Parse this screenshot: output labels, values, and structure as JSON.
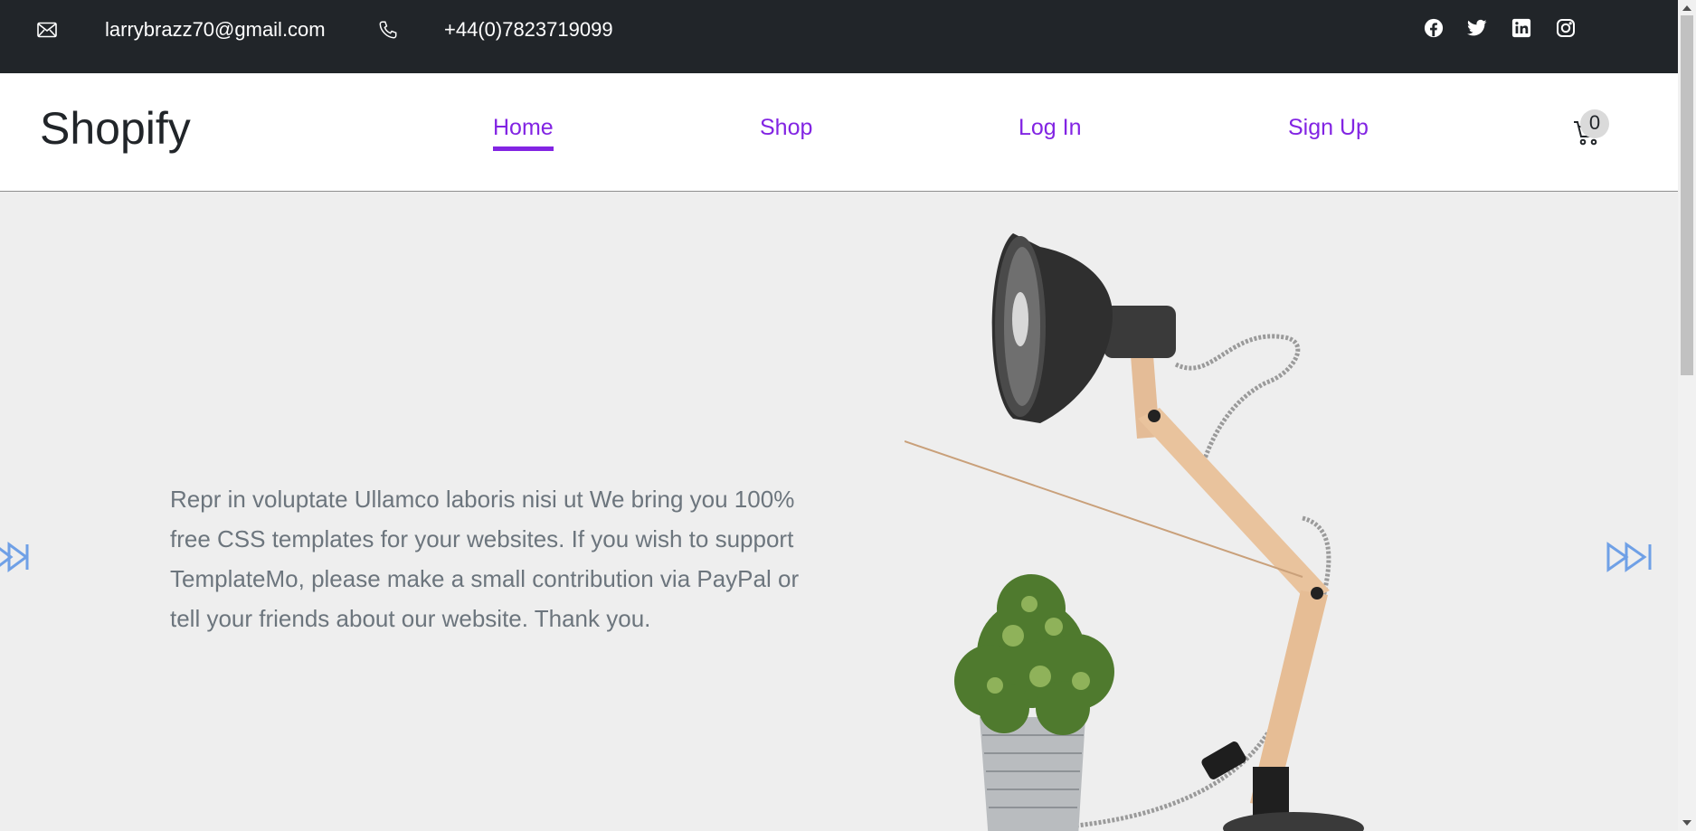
{
  "topbar": {
    "email": "larrybrazz70@gmail.com",
    "phone": "+44(0)7823719099",
    "icons": [
      "envelope-icon",
      "phone-icon"
    ],
    "social": [
      "facebook-icon",
      "twitter-icon",
      "linkedin-icon",
      "instagram-icon"
    ]
  },
  "header": {
    "brand": "Shopify",
    "nav": [
      {
        "label": "Home",
        "active": true
      },
      {
        "label": "Shop",
        "active": false
      },
      {
        "label": "Log In",
        "active": false
      },
      {
        "label": "Sign Up",
        "active": false
      }
    ],
    "cart_count": "0"
  },
  "hero": {
    "text": "Repr in voluptate Ullamco laboris nisi ut We bring you 100% free CSS templates for your websites. If you wish to support TemplateMo, please make a small contribution via PayPal or tell your friends about our website. Thank you.",
    "image": "desk-lamp-with-plant",
    "prev_icon": "skip-back-icon",
    "next_icon": "skip-forward-icon"
  },
  "colors": {
    "topbar_bg": "#212529",
    "accent": "#8224e3",
    "hero_bg": "#eeeeee",
    "arrow": "#6fa0e6"
  }
}
